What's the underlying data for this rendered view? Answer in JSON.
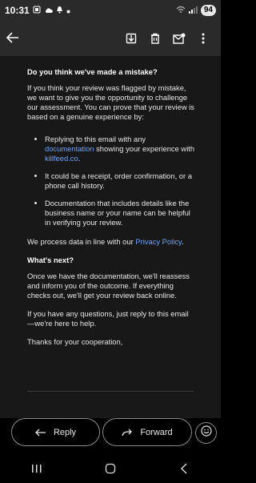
{
  "status": {
    "time": "10:31",
    "battery": "94",
    "left_icons": [
      "sim-icon",
      "cloud-icon",
      "notification-bell-icon",
      "dot-icon"
    ],
    "right_icons": [
      "wifi-icon",
      "signal-icon"
    ]
  },
  "toolbar": {
    "back_icon": "arrow-left-icon",
    "actions": [
      "archive-icon",
      "delete-icon",
      "mark-unread-icon",
      "more-vert-icon"
    ]
  },
  "email": {
    "heading1": "Do you think we've made a mistake?",
    "para1": "If you think your review was flagged by mistake, we want to give you the opportunity to challenge our assessment. You can prove that your review is based on a genuine experience by:",
    "bullet1_prefix": "Replying to this email with any ",
    "bullet1_link": "documentation",
    "bullet1_middle": " showing your experience with ",
    "bullet1_link2": "killfeed.co",
    "bullet1_suffix": ".",
    "bullet2": "It could be a receipt, order confirmation, or a phone call history.",
    "bullet3": "Documentation that includes details like the business name or your name can be helpful in verifying your review.",
    "privacy_prefix": "We process data in line with our ",
    "privacy_link": "Privacy Policy",
    "privacy_suffix": ".",
    "heading2": "What's next?",
    "para2": "Once we have the documentation, we'll reassess and inform you of the outcome. If everything checks out, we'll get your review back online.",
    "para3": "If you have any questions, just reply to this email—we're here to help.",
    "para4": "Thanks for your cooperation,"
  },
  "actions": {
    "reply_label": "Reply",
    "forward_label": "Forward",
    "emoji_icon": "emoji-smile-icon"
  },
  "navbar": {
    "items": [
      "recents-icon",
      "home-icon",
      "back-icon"
    ]
  },
  "colors": {
    "link": "#6aa3ff",
    "background": "#181818",
    "bar": "#2a2a2a"
  }
}
